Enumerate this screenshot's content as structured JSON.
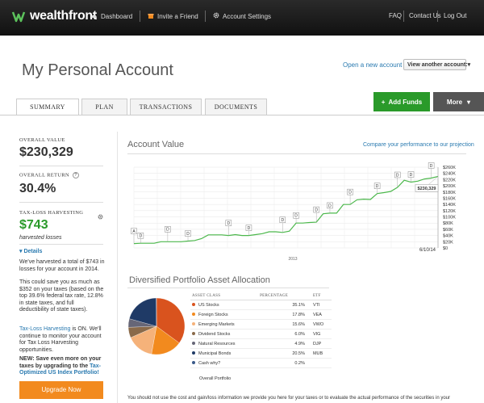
{
  "brand": {
    "name": "wealthfront",
    "color": "#2a9a2a"
  },
  "nav": {
    "dashboard": "Dashboard",
    "invite": "Invite a Friend",
    "settings": "Account Settings",
    "faq": "FAQ",
    "contact": "Contact Us",
    "logout": "Log Out"
  },
  "header": {
    "title": "My Personal Account",
    "open_link": "Open a new account",
    "view_select": "View another account:",
    "add_funds": "Add Funds",
    "more": "More"
  },
  "tabs": [
    "SUMMARY",
    "PLAN",
    "TRANSACTIONS",
    "DOCUMENTS"
  ],
  "summary": {
    "overall_value_label": "OVERALL VALUE",
    "overall_value": "$230,329",
    "overall_return_label": "OVERALL RETURN",
    "overall_return": "30.4%",
    "tlh_label": "TAX-LOSS HARVESTING",
    "tlh_value": "$743",
    "tlh_sub": "harvested losses",
    "details": "Details",
    "p1": "We've harvested a total of $743 in losses for your account in 2014.",
    "p2": "This could save you as much as $352 on your taxes (based on the top 39.6% federal tax rate, 12.8% in state taxes, and full deductibility of state taxes).",
    "p3_link": "Tax-Loss Harvesting",
    "p3_rest": " is ON. We'll continue to monitor your account for Tax Loss Harvesting opportunities.",
    "p4_start": "NEW: Save even more on your taxes by upgrading to the ",
    "p4_link": "Tax-Optimized US Index Portfolio!",
    "upgrade": "Upgrade Now"
  },
  "account_value": {
    "title": "Account Value",
    "compare_link": "Compare your performance to our projection",
    "current_label": "$230,329",
    "date_label": "6/10/14",
    "year_label": "2013"
  },
  "chart_data": {
    "type": "line",
    "title": "Account Value",
    "y_ticks": [
      "$260K",
      "$240K",
      "$220K",
      "$200K",
      "$180K",
      "$160K",
      "$140K",
      "$120K",
      "$100K",
      "$80K",
      "$60K",
      "$40K",
      "$20K",
      "$0"
    ],
    "ylim": [
      0,
      260000
    ],
    "x_labels": [
      "2013",
      "6/10/14"
    ],
    "series": [
      {
        "values": [
          14000,
          15000,
          15000,
          15000,
          20000,
          20000,
          20000,
          20000,
          22000,
          24000,
          30000,
          42000,
          42000,
          42000,
          40000,
          43000,
          40000,
          40000,
          43000,
          46000,
          52000,
          52000,
          50000,
          54000,
          80000,
          80000,
          82000,
          83000,
          110000,
          112000,
          112000,
          140000,
          140000,
          155000,
          157000,
          156000,
          175000,
          178000,
          182000,
          195000,
          218000,
          212000,
          215000,
          222000,
          225000,
          230329
        ]
      }
    ],
    "markers": [
      {
        "label": "A",
        "index": 0
      },
      {
        "label": "D",
        "index": 1
      },
      {
        "label": "D",
        "index": 5
      },
      {
        "label": "D",
        "index": 8
      },
      {
        "label": "D",
        "index": 14
      },
      {
        "label": "D",
        "index": 17
      },
      {
        "label": "D",
        "index": 22
      },
      {
        "label": "D",
        "index": 24
      },
      {
        "label": "D",
        "index": 27
      },
      {
        "label": "D",
        "index": 29
      },
      {
        "label": "D",
        "index": 32
      },
      {
        "label": "D",
        "index": 36
      },
      {
        "label": "D",
        "index": 39
      },
      {
        "label": "D",
        "index": 41
      },
      {
        "label": "D",
        "index": 44
      }
    ]
  },
  "allocation": {
    "title": "Diversified Portfolio Asset Allocation",
    "headers": {
      "asset": "ASSET CLASS",
      "pct": "PERCENTAGE",
      "etf": "ETF"
    },
    "rows": [
      {
        "name": "US Stocks",
        "pct": "35.1%",
        "etf": "VTI",
        "value": 35.1,
        "color": "#d9531e"
      },
      {
        "name": "Foreign Stocks",
        "pct": "17.8%",
        "etf": "VEA",
        "value": 17.8,
        "color": "#f28a1e"
      },
      {
        "name": "Emerging Markets",
        "pct": "15.6%",
        "etf": "VWO",
        "value": 15.6,
        "color": "#f5b27a"
      },
      {
        "name": "Dividend Stocks",
        "pct": "6.0%",
        "etf": "VIG",
        "value": 6.0,
        "color": "#8a6a4a"
      },
      {
        "name": "Natural Resources",
        "pct": "4.9%",
        "etf": "DJP",
        "value": 4.9,
        "color": "#666677"
      },
      {
        "name": "Municipal Bonds",
        "pct": "20.5%",
        "etf": "MUB",
        "value": 20.5,
        "color": "#1f3a66"
      },
      {
        "name": "Cash why?",
        "pct": "0.2%",
        "etf": "",
        "value": 0.2,
        "color": "#3a5a8a"
      }
    ],
    "overall": "Overall Portfolio"
  },
  "footnote": "You should not use the cost and gain/loss information we provide you here for your taxes or to evaluate the actual performance of the securities in your"
}
